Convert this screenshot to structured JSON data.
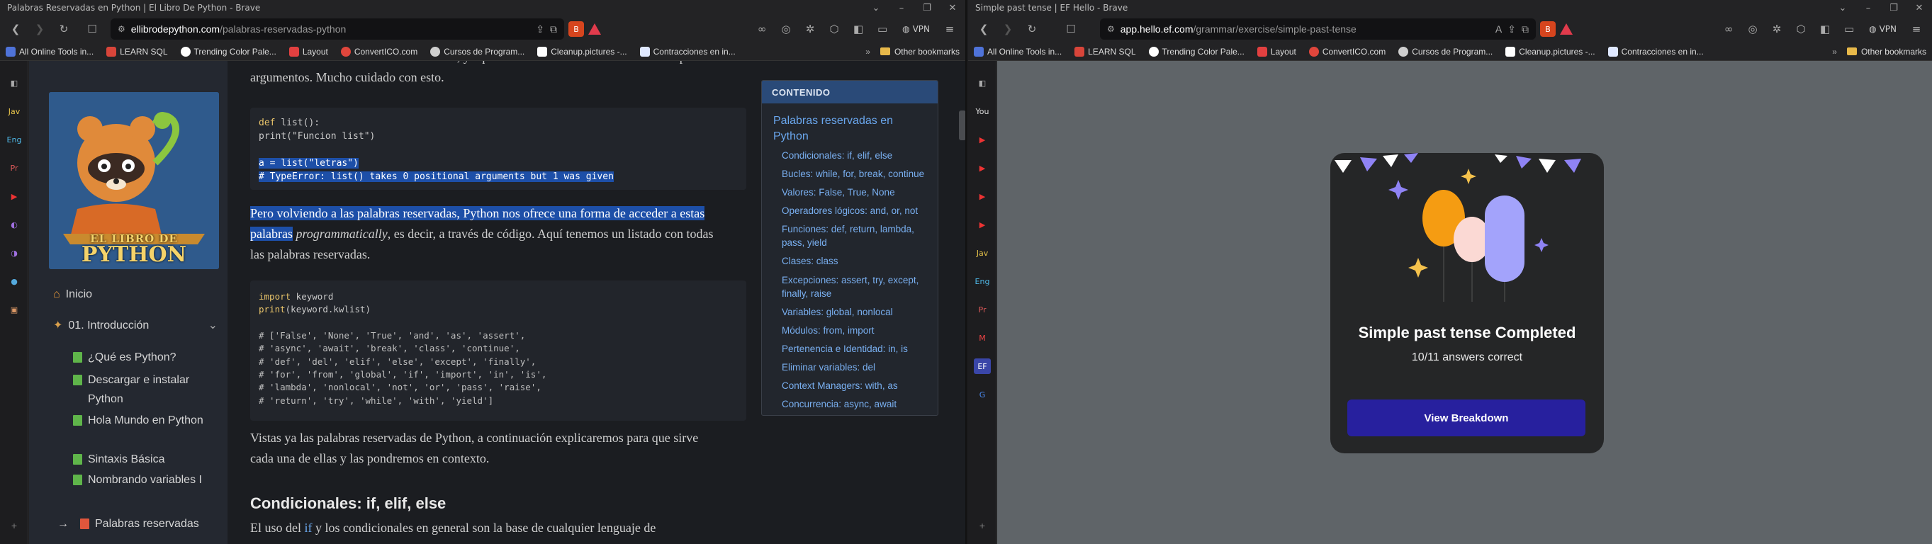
{
  "left_window": {
    "title": "Palabras Reservadas en Python | El Libro De Python - Brave",
    "url_host": "ellibrodepython.com",
    "url_path": "/palabras-reservadas-python",
    "vpn_label": "VPN",
    "bookmarks": [
      {
        "label": "All Online Tools in...",
        "color": "#4f73d9"
      },
      {
        "label": "LEARN SQL",
        "color": "#d8453a"
      },
      {
        "label": "Trending Color Pale...",
        "color": "#ffffff"
      },
      {
        "label": "Layout",
        "color": "#e24040"
      },
      {
        "label": "ConvertICO.com",
        "color": "#e0463c"
      },
      {
        "label": "Cursos de Program...",
        "color": "#cfcfcf"
      },
      {
        "label": "Cleanup.pictures -...",
        "color": "#ffffff"
      },
      {
        "label": "Contracciones en in...",
        "color": "#dfe8ff"
      }
    ],
    "other_bookmarks": "Other bookmarks",
    "vertical_tabs": [
      "Jav",
      "Eng",
      "Pr"
    ]
  },
  "sidebar": {
    "logo_line1": "EL LIBRO DE",
    "logo_line2": "PYTHON",
    "items": [
      {
        "label": "Inicio"
      },
      {
        "label": "01. Introducción"
      },
      {
        "label": "¿Qué es Python?"
      },
      {
        "label": "Descargar e instalar Python"
      },
      {
        "label": "Hola Mundo en Python"
      },
      {
        "label": "Sintaxis Básica"
      },
      {
        "label": "Nombrando variables I"
      },
      {
        "label": "Palabras reservadas"
      }
    ]
  },
  "article": {
    "intro_line1": "al intentar hacer la llamada anterior falla, ya que nuestra función en este caso no acepta",
    "intro_line2": "argumentos. Mucho cuidado con esto.",
    "code1": {
      "l1_kw": "def",
      "l1_rest": " list():",
      "l2": "    print(\"Funcion list\")",
      "l3": "a = list(\"letras\")",
      "l4": "# TypeError: list() takes 0 positional arguments but 1 was given"
    },
    "para2_sel1": "Pero volviendo a las palabras reservadas, Python nos ofrece una forma de acceder a estas",
    "para2_sel2": "palabras",
    "para2_em": "programmatically",
    "para2_rest": ", es decir, a través de código. Aquí tenemos un listado con todas",
    "para2_line3": "las palabras reservadas.",
    "code2": {
      "l1_kw": "import",
      "l1_rest": " keyword",
      "l2_kw": "print",
      "l2_rest": "(keyword.kwlist)",
      "comments": [
        "# ['False', 'None', 'True', 'and', 'as', 'assert',",
        "# 'async', 'await', 'break', 'class', 'continue',",
        "# 'def', 'del', 'elif', 'else', 'except', 'finally',",
        "# 'for', 'from', 'global', 'if', 'import', 'in', 'is',",
        "# 'lambda', 'nonlocal', 'not', 'or', 'pass', 'raise',",
        "# 'return', 'try', 'while', 'with', 'yield']"
      ]
    },
    "para3_line1": "Vistas ya las palabras reservadas de Python, a continuación explicaremos para que sirve",
    "para3_line2": "cada una de ellas y las pondremos en contexto.",
    "heading": "Condicionales: if, elif, else",
    "para4_a": "El uso del ",
    "para4_if": "if",
    "para4_b": " y los condicionales en general son la base de cualquier lenguaje de"
  },
  "toc": {
    "header": "CONTENIDO",
    "main": "Palabras reservadas en Python",
    "items": [
      "Condicionales: if, elif, else",
      "Bucles: while, for, break, continue",
      "Valores: False, True, None",
      "Operadores lógicos: and, or, not",
      "Funciones: def, return, lambda, pass, yield",
      "Clases: class",
      "Excepciones: assert, try, except, finally, raise",
      "Variables: global, nonlocal",
      "Módulos: from, import",
      "Pertenencia e Identidad: in, is",
      "Eliminar variables: del",
      "Context Managers: with, as",
      "Concurrencia: async, await"
    ]
  },
  "right_window": {
    "title": "Simple past tense | EF Hello - Brave",
    "url_host": "app.hello.ef.com",
    "url_path": "/grammar/exercise/simple-past-tense",
    "vpn_label": "VPN",
    "bookmarks": [
      {
        "label": "All Online Tools in...",
        "color": "#4f73d9"
      },
      {
        "label": "LEARN SQL",
        "color": "#d8453a"
      },
      {
        "label": "Trending Color Pale...",
        "color": "#ffffff"
      },
      {
        "label": "Layout",
        "color": "#e24040"
      },
      {
        "label": "ConvertICO.com",
        "color": "#e0463c"
      },
      {
        "label": "Cursos de Program...",
        "color": "#cfcfcf"
      },
      {
        "label": "Cleanup.pictures -...",
        "color": "#ffffff"
      },
      {
        "label": "Contracciones en in...",
        "color": "#dfe8ff"
      }
    ],
    "other_bookmarks": "Other bookmarks",
    "vertical_tabs": [
      "You",
      "Jav",
      "Eng",
      "Pr"
    ]
  },
  "completion_card": {
    "title": "Simple past tense Completed",
    "score": "10/11 answers correct",
    "button": "View Breakdown"
  }
}
